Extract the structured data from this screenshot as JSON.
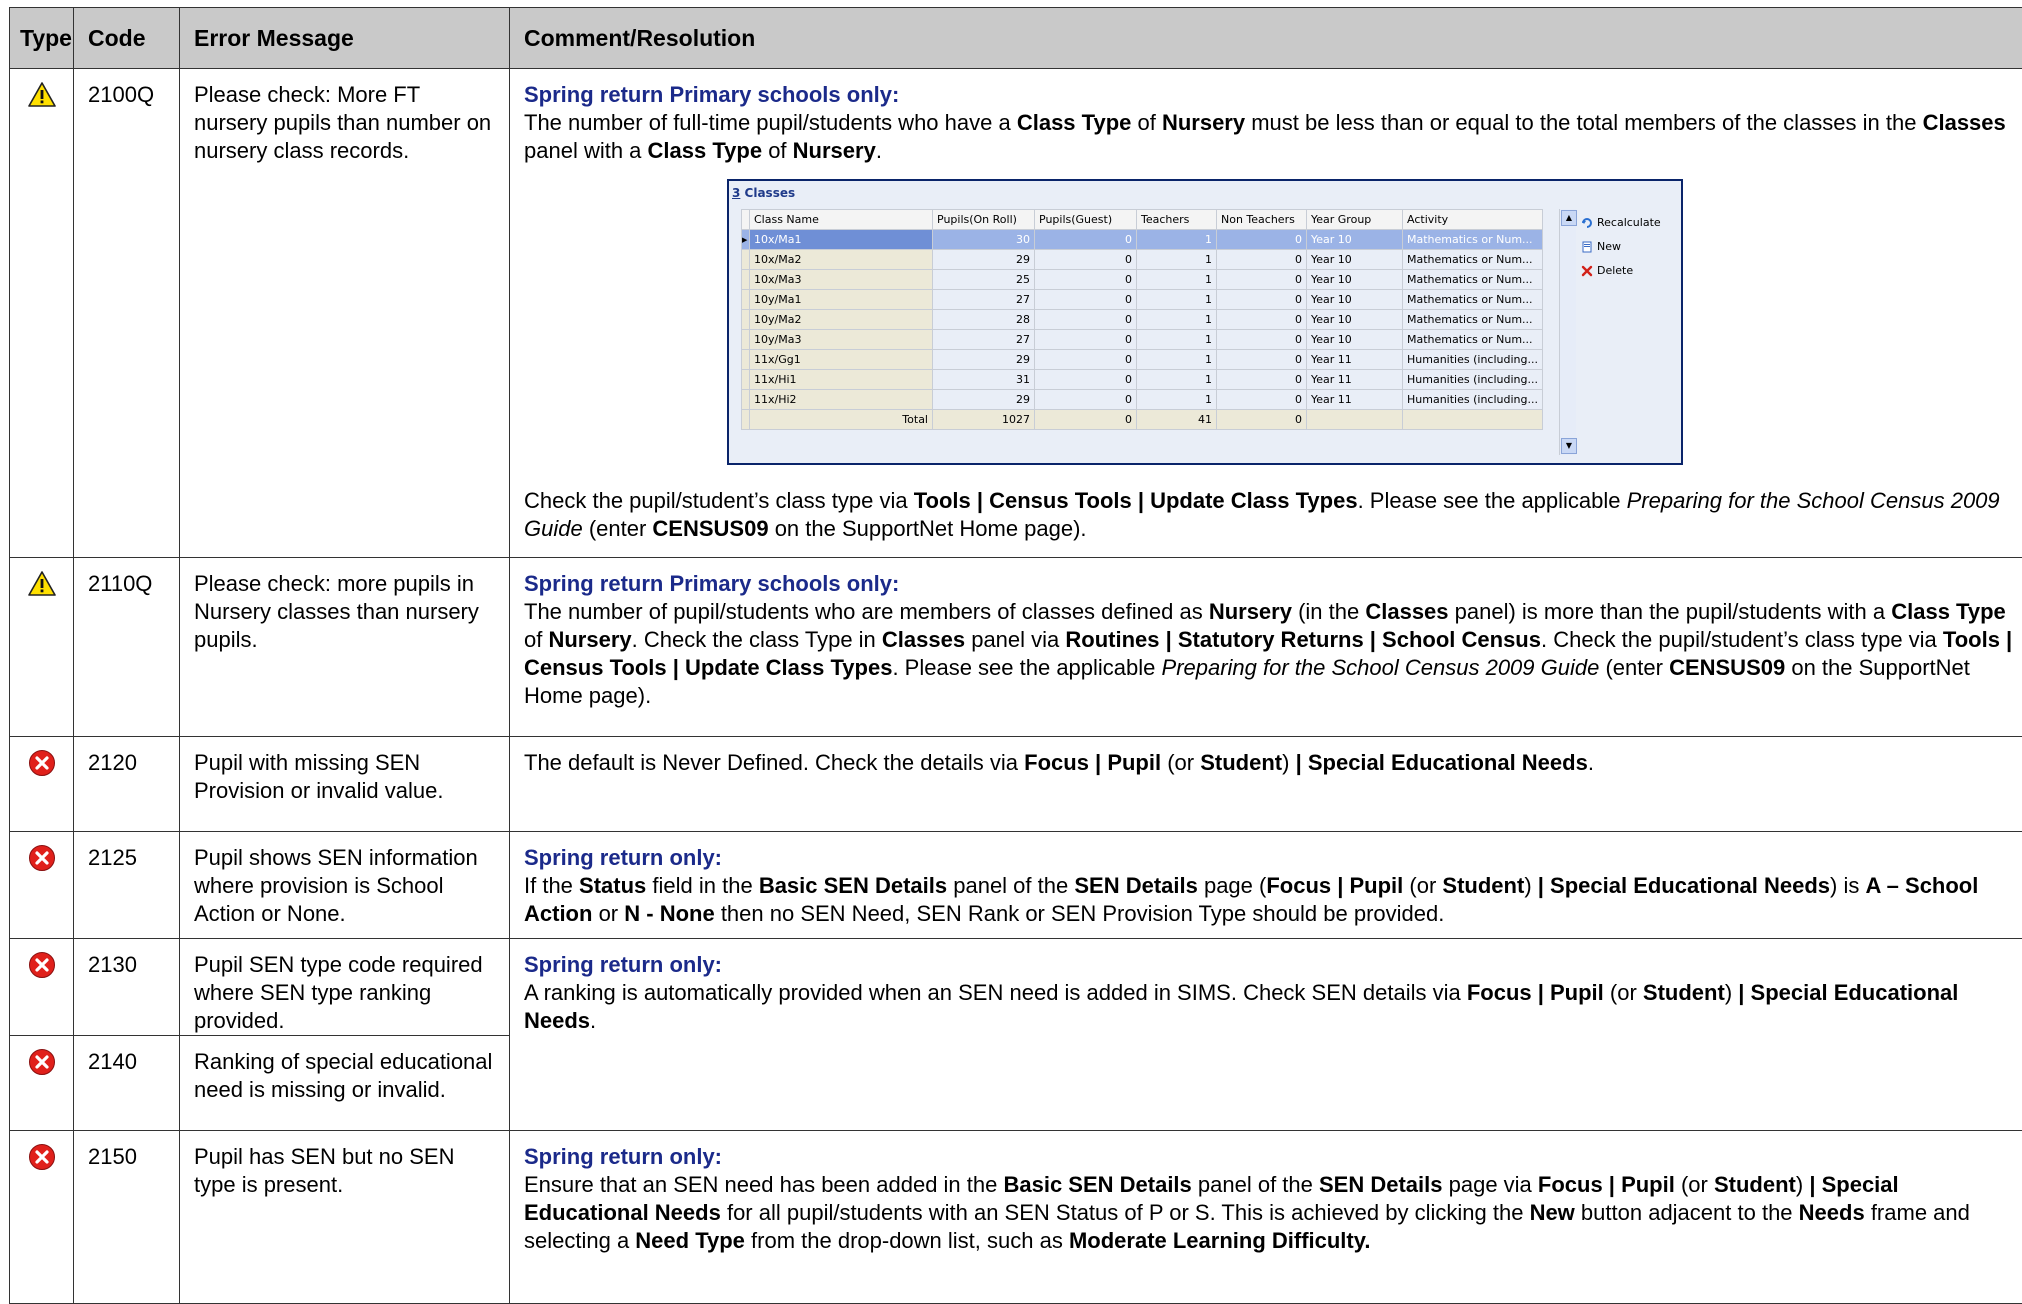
{
  "headers": {
    "type": "Type",
    "code": "Code",
    "message": "Error Message",
    "comment": "Comment/Resolution"
  },
  "rows": [
    {
      "icon": "warning-icon",
      "code": "2100Q",
      "message": "Please check: More FT nursery pupils than number on nursery class records.",
      "heading": "Spring return Primary schools only:",
      "p1": {
        "a": "The number of full-time pupil/students who have a ",
        "b": "Class Type",
        "c": " of ",
        "d": "Nursery",
        "e": " must be less than or equal to the total members of the classes in the ",
        "f": "Classes",
        "g": " panel with a ",
        "h": "Class Type",
        "i": " of ",
        "j": "Nursery",
        "k": "."
      },
      "p2": {
        "a": "Check the pupil/student’s class type via ",
        "b": "Tools | Census Tools | Update Class Types",
        "c": ". Please see the applicable ",
        "d": "Preparing for the School Census 2009 Guide",
        "e": " (enter ",
        "f": "CENSUS09",
        "g": " on the SupportNet Home page)."
      }
    },
    {
      "icon": "warning-icon",
      "code": "2110Q",
      "message": "Please check: more pupils in Nursery classes than nursery pupils.",
      "heading": "Spring return Primary schools only:",
      "p1": {
        "a": "The number of pupil/students who are members of classes defined as ",
        "b": "Nursery",
        "c": " (in the ",
        "d": "Classes",
        "e": " panel) is more than the pupil/students with a ",
        "f": "Class Type",
        "g": " of ",
        "h": "Nursery",
        "i": ". Check the class Type in ",
        "j": "Classes",
        "k": " panel via ",
        "l": "Routines | Statutory Returns | School Census",
        "m": ". Check the pupil/student’s class type via ",
        "n": "Tools | Census Tools | Update Class Types",
        "o": ". Please see the applicable ",
        "p": "Preparing for the School Census 2009 Guide",
        "q": " (enter ",
        "r": "CENSUS09",
        "s": " on the SupportNet Home page)."
      }
    },
    {
      "icon": "error-icon",
      "code": "2120",
      "message": "Pupil with missing SEN Provision or invalid value.",
      "p1": {
        "a": "The default is Never Defined. Check the details via ",
        "b": "Focus | Pupil",
        "c": " (or ",
        "d": "Student",
        "e": ") ",
        "f": "| Special Educational Needs",
        "g": "."
      }
    },
    {
      "icon": "error-icon",
      "code": "2125",
      "message": "Pupil shows SEN information where provision is School Action or None.",
      "heading": "Spring return only:",
      "p1": {
        "a": "If the ",
        "b": "Status",
        "c": " field in the ",
        "d": "Basic SEN Details",
        "e": " panel of the ",
        "f": "SEN Details",
        "g": " page (",
        "h": "Focus | Pupil",
        "i": " (or ",
        "j": "Student",
        "k": ") ",
        "l": "| Special Educational Needs",
        "m": ") is ",
        "n": "A – School Action",
        "o": " or ",
        "p": "N - None",
        "q": " then no SEN Need, SEN Rank or SEN Provision Type should be provided."
      }
    },
    {
      "icon": "error-icon",
      "code": "2130",
      "message": "Pupil SEN type code required where SEN type ranking provided.",
      "heading": "Spring return only:",
      "p1": {
        "a": "A ranking is automatically provided when an SEN need is added in SIMS. Check SEN details via ",
        "b": "Focus | Pupil",
        "c": " (or ",
        "d": "Student",
        "e": ") ",
        "f": "| Special Educational Needs",
        "g": "."
      }
    },
    {
      "icon": "error-icon",
      "code": "2140",
      "message": "Ranking of special educational need is missing or invalid."
    },
    {
      "icon": "error-icon",
      "code": "2150",
      "message": "Pupil has SEN but no SEN type is present.",
      "heading": "Spring return only:",
      "p1": {
        "a": "Ensure that an SEN need has been added in the ",
        "b": "Basic SEN Details",
        "c": " panel of the ",
        "d": "SEN Details",
        "e": " page via ",
        "f": "Focus | Pupil",
        "g": " (or ",
        "h": "Student",
        "i": ") ",
        "j": "| Special Educational Needs",
        "k": " for all pupil/students with an SEN Status of P or S. This is achieved by clicking the ",
        "l": "New",
        "m": " button adjacent to the ",
        "n": "Needs",
        "o": " frame and selecting a ",
        "p": "Need Type",
        "q": " from the drop-down list, such as ",
        "r": "Moderate Learning Difficulty."
      }
    }
  ],
  "classes_panel": {
    "title_num": "3",
    "title": " Classes",
    "columns": [
      "Class Name",
      "Pupils(On Roll)",
      "Pupils(Guest)",
      "Teachers",
      "Non Teachers",
      "Year Group",
      "Activity"
    ],
    "rows": [
      [
        "10x/Ma1",
        "30",
        "0",
        "1",
        "0",
        "Year 10",
        "Mathematics or Num..."
      ],
      [
        "10x/Ma2",
        "29",
        "0",
        "1",
        "0",
        "Year 10",
        "Mathematics or Num..."
      ],
      [
        "10x/Ma3",
        "25",
        "0",
        "1",
        "0",
        "Year 10",
        "Mathematics or Num..."
      ],
      [
        "10y/Ma1",
        "27",
        "0",
        "1",
        "0",
        "Year 10",
        "Mathematics or Num..."
      ],
      [
        "10y/Ma2",
        "28",
        "0",
        "1",
        "0",
        "Year 10",
        "Mathematics or Num..."
      ],
      [
        "10y/Ma3",
        "27",
        "0",
        "1",
        "0",
        "Year 10",
        "Mathematics or Num..."
      ],
      [
        "11x/Gg1",
        "29",
        "0",
        "1",
        "0",
        "Year 11",
        "Humanities (including..."
      ],
      [
        "11x/Hi1",
        "31",
        "0",
        "1",
        "0",
        "Year 11",
        "Humanities (including..."
      ],
      [
        "11x/Hi2",
        "29",
        "0",
        "1",
        "0",
        "Year 11",
        "Humanities (including..."
      ]
    ],
    "total_label": "Total",
    "totals": [
      "1027",
      "0",
      "41",
      "0"
    ],
    "actions": {
      "recalculate": "Recalculate",
      "new": "New",
      "delete": "Delete"
    }
  },
  "colors": {
    "heading": "#1b2a8a",
    "header_bg": "#c9c9c9",
    "warning": "#ffd700",
    "error": "#e0201b"
  }
}
